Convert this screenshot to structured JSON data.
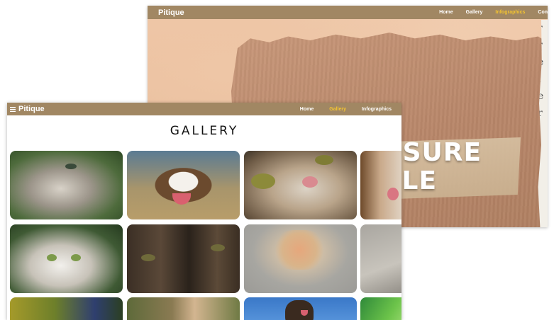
{
  "back_window": {
    "brand": "Pitique",
    "nav": [
      "Home",
      "Gallery",
      "Infographics",
      "Con"
    ],
    "active_nav": "Infographics",
    "hero_lines": [
      "OSURE",
      "GLE"
    ],
    "newsprint": [
      "r",
      "r",
      "e",
      "i",
      "e",
      "r"
    ]
  },
  "front_window": {
    "brand": "Pitique",
    "nav": [
      "Home",
      "Gallery",
      "Infographics"
    ],
    "active_nav": "Gallery",
    "title": "GALLERY"
  },
  "colors": {
    "nav_bg": "#a18763",
    "nav_active": "#f4c430",
    "nav_text": "#ffffff"
  },
  "icons": [
    "menu-icon"
  ]
}
